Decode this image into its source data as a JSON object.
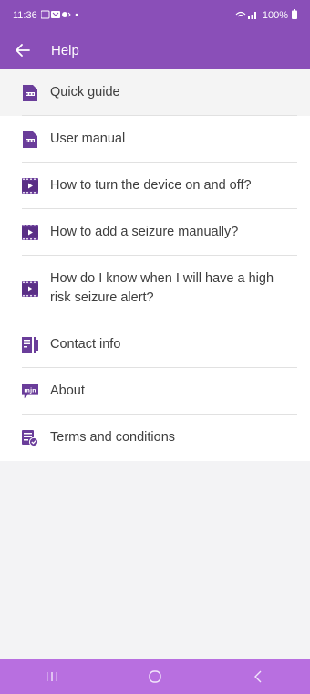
{
  "status_bar": {
    "time": "11:36",
    "battery": "100%"
  },
  "app_bar": {
    "title": "Help",
    "back_icon": "arrow-left-icon"
  },
  "items": [
    {
      "label": "Quick guide",
      "icon": "pdf-icon"
    },
    {
      "label": "User manual",
      "icon": "pdf-icon"
    },
    {
      "label": "How to turn the device on and off?",
      "icon": "video-icon"
    },
    {
      "label": "How to add a seizure manually?",
      "icon": "video-icon"
    },
    {
      "label": "How do I know when I will have a high risk seizure alert?",
      "icon": "video-icon"
    },
    {
      "label": "Contact info",
      "icon": "contact-icon"
    },
    {
      "label": "About",
      "icon": "mjn-logo-icon"
    },
    {
      "label": "Terms and conditions",
      "icon": "terms-icon"
    }
  ],
  "nav_bar": {
    "recent": "recent-apps-icon",
    "home": "home-icon",
    "back": "back-icon"
  },
  "colors": {
    "brand": "#8a4fb8",
    "icon": "#6a3d9a",
    "nav_bar": "#b86fe0"
  }
}
